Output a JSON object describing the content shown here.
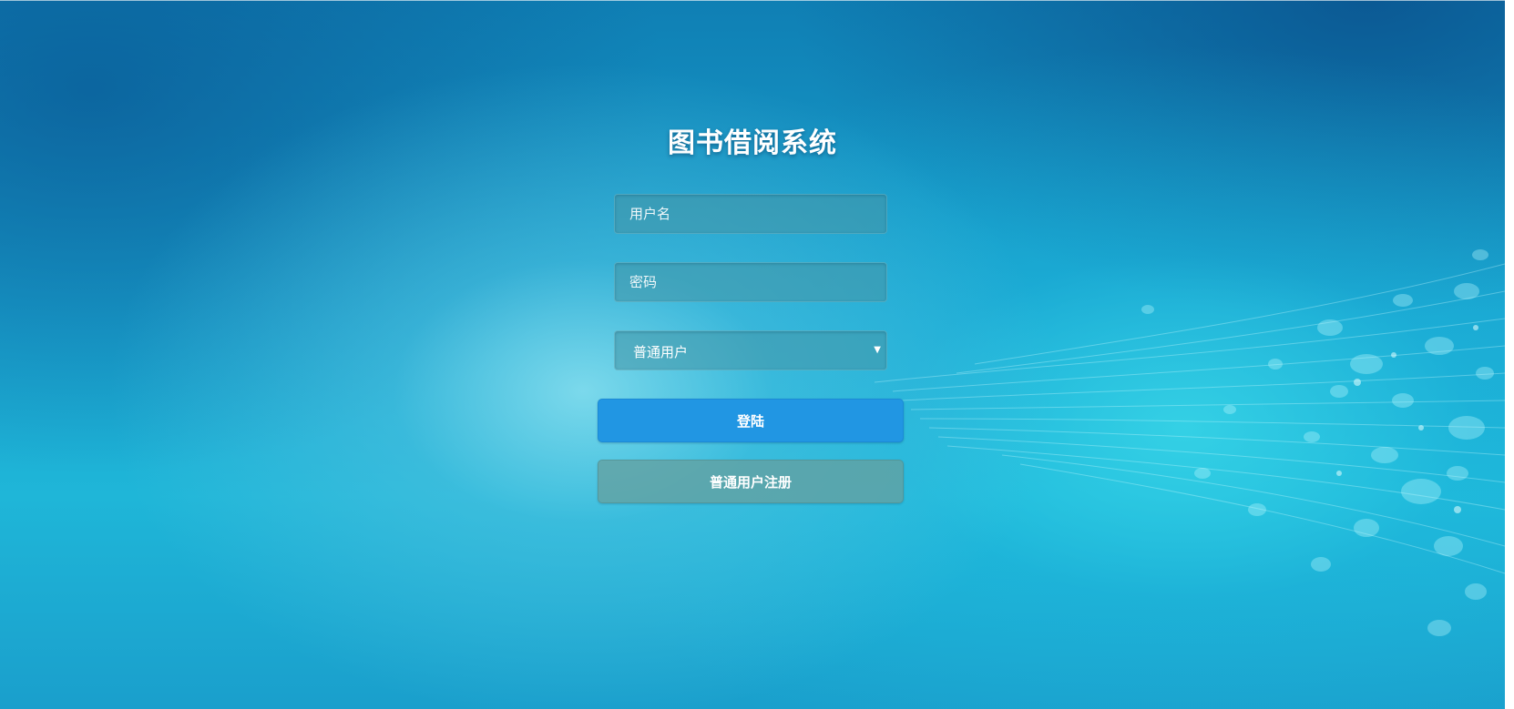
{
  "login_page": {
    "title": "图书借阅系统",
    "username": {
      "placeholder": "用户名",
      "value": ""
    },
    "password": {
      "placeholder": "密码",
      "value": ""
    },
    "role_select": {
      "selected": "普通用户",
      "arrow_icon": "triangle-down-icon"
    },
    "login_button": "登陆",
    "register_button": "普通用户注册"
  },
  "colors": {
    "login_button": "#2196e3",
    "register_button": "#64a0a0",
    "background_deep": "#0f7fb4",
    "background_light": "#3fd8e6"
  }
}
